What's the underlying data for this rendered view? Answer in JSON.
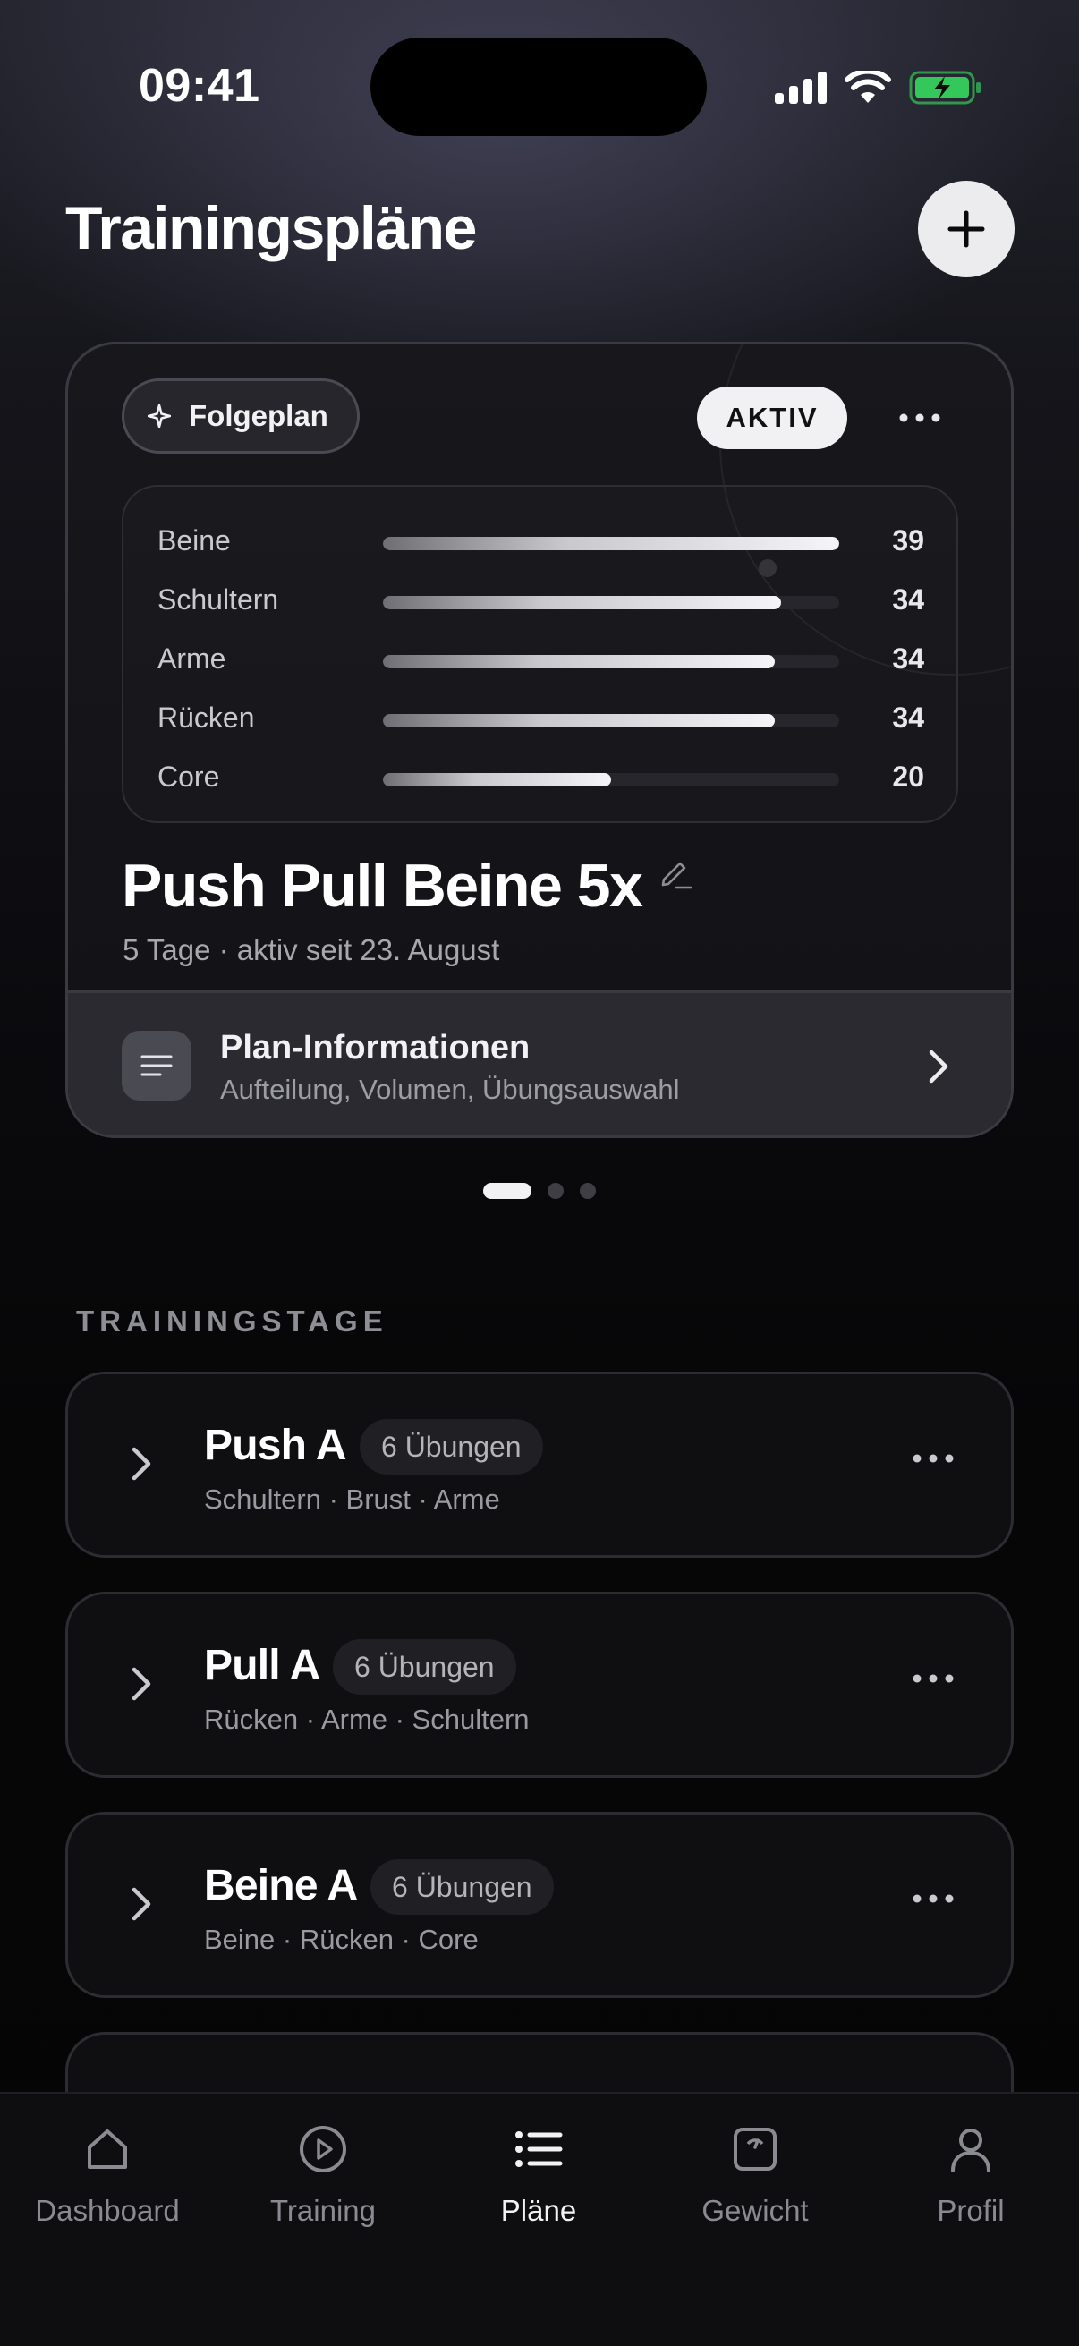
{
  "status_bar": {
    "time": "09:41"
  },
  "header": {
    "title": "Trainingspläne"
  },
  "plan_card": {
    "tag_label": "Folgeplan",
    "status_badge": "AKTIV",
    "muscles": [
      {
        "name": "Beine",
        "value": "39",
        "fill": 1.0
      },
      {
        "name": "Schultern",
        "value": "34",
        "fill": 0.872
      },
      {
        "name": "Arme",
        "value": "34",
        "fill": 0.858
      },
      {
        "name": "Rücken",
        "value": "34",
        "fill": 0.858
      },
      {
        "name": "Core",
        "value": "20",
        "fill": 0.5
      }
    ],
    "name": "Push Pull Beine 5x",
    "subtitle": "5 Tage · aktiv seit 23. August",
    "info": {
      "title": "Plan-Informationen",
      "subtitle": "Aufteilung, Volumen, Übungsauswahl"
    }
  },
  "pager": {
    "count": 3,
    "active": 0
  },
  "section": {
    "title": "TRAININGSTAGE"
  },
  "training_days": [
    {
      "title": "Push A",
      "badge": "6 Übungen",
      "muscles": "Schultern · Brust · Arme"
    },
    {
      "title": "Pull A",
      "badge": "6 Übungen",
      "muscles": "Rücken · Arme · Schultern"
    },
    {
      "title": "Beine A",
      "badge": "6 Übungen",
      "muscles": "Beine · Rücken · Core"
    }
  ],
  "tab_bar": {
    "active": "Pläne",
    "tabs": [
      {
        "label": "Dashboard",
        "icon": "house-icon"
      },
      {
        "label": "Training",
        "icon": "play-circle-icon"
      },
      {
        "label": "Pläne",
        "icon": "list-icon"
      },
      {
        "label": "Gewicht",
        "icon": "scale-icon"
      },
      {
        "label": "Profil",
        "icon": "person-icon"
      }
    ]
  },
  "colors": {
    "background": "#050506",
    "card": "#121216",
    "accent_light": "#f1f1f3",
    "battery_green": "#34c759"
  }
}
